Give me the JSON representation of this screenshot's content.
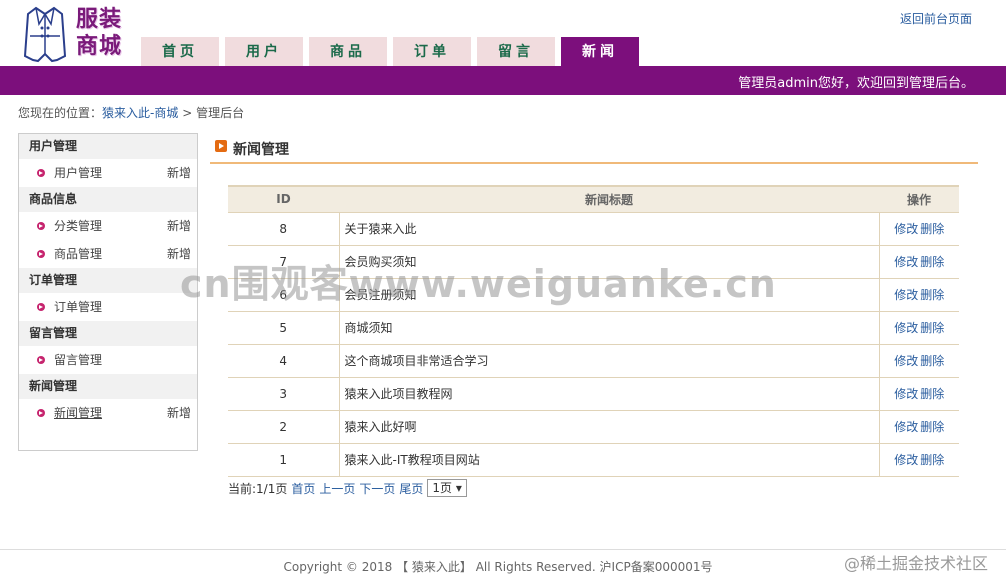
{
  "header": {
    "logo_line1": "服装",
    "logo_line2": "商城",
    "back_link": "返回前台页面",
    "welcome": "管理员admin您好，欢迎回到管理后台。"
  },
  "nav": [
    {
      "label": "首页",
      "active": false
    },
    {
      "label": "用户",
      "active": false
    },
    {
      "label": "商品",
      "active": false
    },
    {
      "label": "订单",
      "active": false
    },
    {
      "label": "留言",
      "active": false
    },
    {
      "label": "新闻",
      "active": true
    }
  ],
  "breadcrumb": {
    "prefix": "您现在的位置：",
    "link": "猿来入此-商城",
    "sep": ">",
    "current": "管理后台"
  },
  "sidebar": {
    "groups": [
      {
        "title": "用户管理",
        "items": [
          {
            "label": "用户管理",
            "add": "新增"
          }
        ]
      },
      {
        "title": "商品信息",
        "items": [
          {
            "label": "分类管理",
            "add": "新增"
          },
          {
            "label": "商品管理",
            "add": "新增"
          }
        ]
      },
      {
        "title": "订单管理",
        "items": [
          {
            "label": "订单管理",
            "add": ""
          }
        ]
      },
      {
        "title": "留言管理",
        "items": [
          {
            "label": "留言管理",
            "add": ""
          }
        ]
      },
      {
        "title": "新闻管理",
        "items": [
          {
            "label": "新闻管理",
            "add": "新增"
          }
        ]
      }
    ]
  },
  "content": {
    "title": "新闻管理",
    "columns": {
      "id": "ID",
      "title": "新闻标题",
      "op": "操作"
    },
    "edit_label": "修改",
    "delete_label": "删除",
    "rows": [
      {
        "id": "8",
        "title": "关于猿来入此"
      },
      {
        "id": "7",
        "title": "会员购买须知"
      },
      {
        "id": "6",
        "title": "会员注册须知"
      },
      {
        "id": "5",
        "title": "商城须知"
      },
      {
        "id": "4",
        "title": "这个商城项目非常适合学习"
      },
      {
        "id": "3",
        "title": "猿来入此项目教程网"
      },
      {
        "id": "2",
        "title": "猿来入此好啊"
      },
      {
        "id": "1",
        "title": "猿来入此-IT教程项目网站"
      }
    ]
  },
  "pager": {
    "current": "当前:1/1页",
    "first": "首页",
    "prev": "上一页",
    "next": "下一页",
    "last": "尾页",
    "select_value": "1页"
  },
  "footer": {
    "copyright": "Copyright © 2018 【 猿来入此】 All Rights Reserved. 沪ICP备案000001号",
    "juejin": "@稀土掘金技术社区"
  },
  "watermark": "cn围观客www.weiguanke.cn"
}
